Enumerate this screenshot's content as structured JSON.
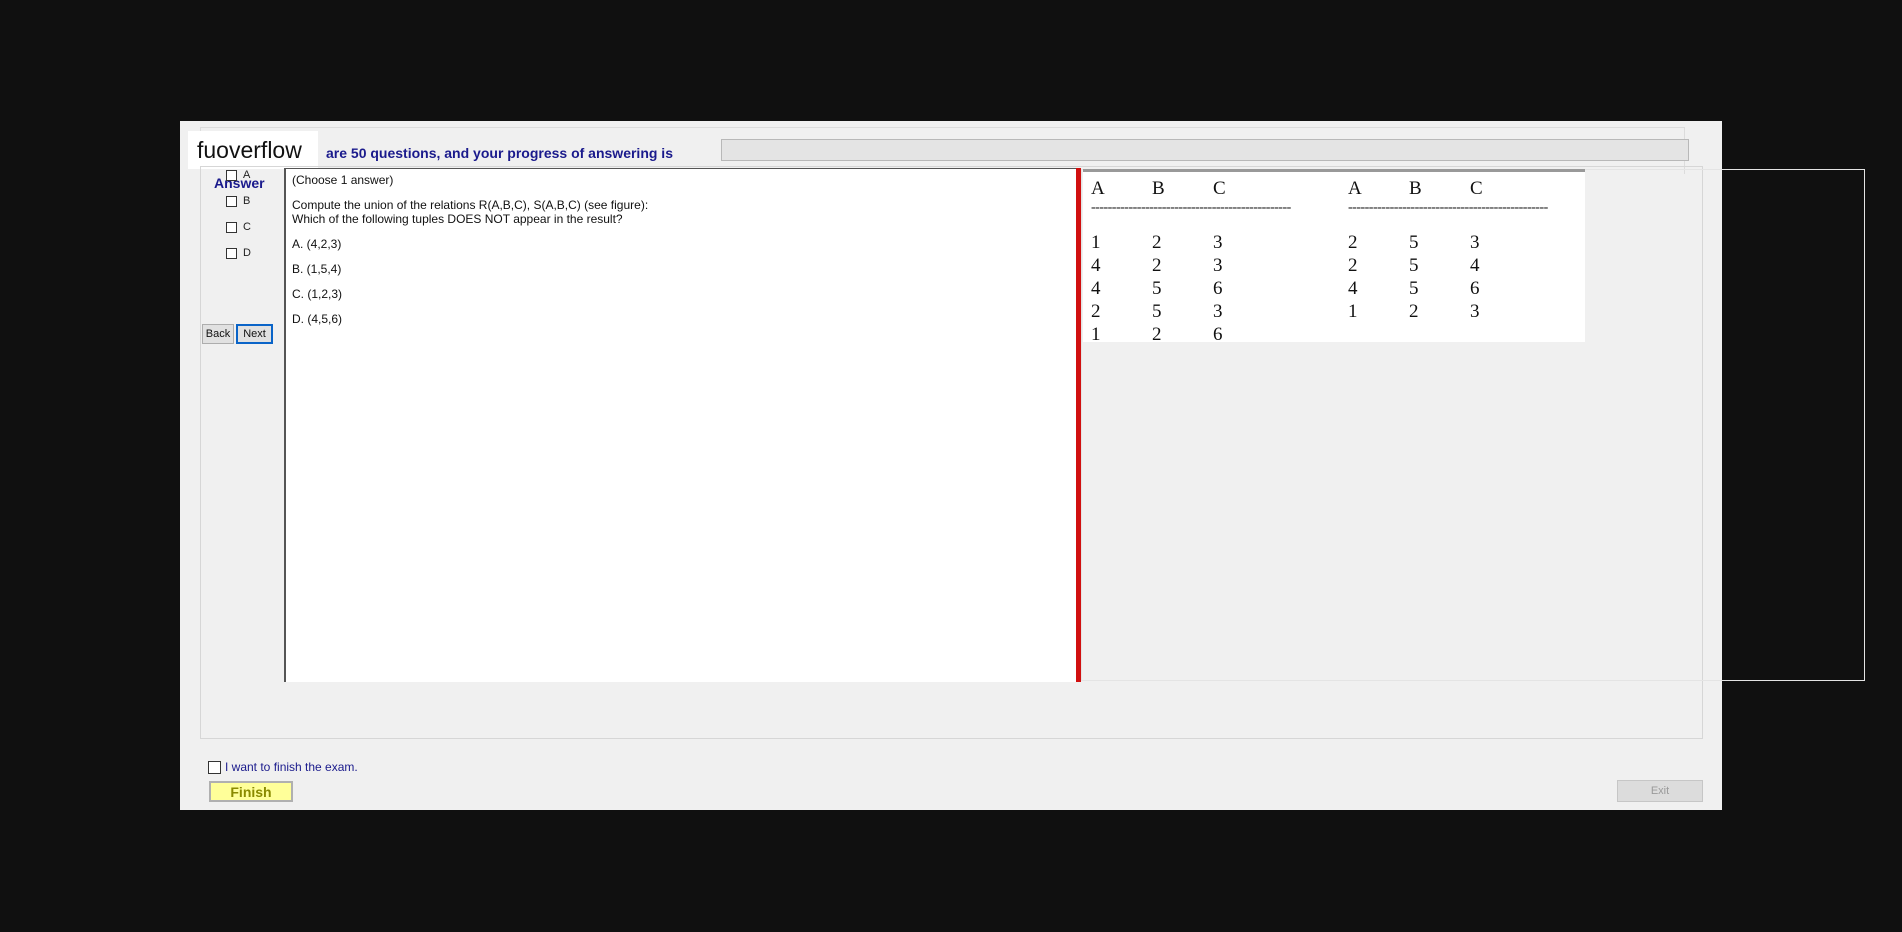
{
  "header": {
    "logo": "fuoverflow",
    "progress_text": "are 50 questions, and your progress of answering is",
    "progress_fraction": 0
  },
  "answer_panel": {
    "title": "Answer",
    "options": [
      "A",
      "B",
      "C",
      "D"
    ],
    "back_label": "Back",
    "next_label": "Next"
  },
  "question": {
    "instruction": "(Choose 1 answer)",
    "text_line1": "Compute the union of the relations R(A,B,C), S(A,B,C) (see figure):",
    "text_line2": "Which of the following tuples DOES NOT appear in the result?",
    "choices": [
      "A.  (4,2,3)",
      "B.  (1,5,4)",
      "C.  (1,2,3)",
      "D.  (4,5,6)"
    ]
  },
  "figure": {
    "relation_r": {
      "headers": [
        "A",
        "B",
        "C"
      ],
      "rows": [
        [
          "1",
          "2",
          "3"
        ],
        [
          "4",
          "2",
          "3"
        ],
        [
          "4",
          "5",
          "6"
        ],
        [
          "2",
          "5",
          "3"
        ],
        [
          "1",
          "2",
          "6"
        ]
      ]
    },
    "relation_s": {
      "headers": [
        "A",
        "B",
        "C"
      ],
      "rows": [
        [
          "2",
          "5",
          "3"
        ],
        [
          "2",
          "5",
          "4"
        ],
        [
          "4",
          "5",
          "6"
        ],
        [
          "1",
          "2",
          "3"
        ]
      ]
    },
    "separator": "------------------------------------------------"
  },
  "footer": {
    "finish_checkbox_label": "I want to finish the exam.",
    "finish_label": "Finish",
    "exit_label": "Exit"
  },
  "colors": {
    "accent_text": "#1a1a8c",
    "splitter": "#d11010",
    "finish_bg": "#ffff99"
  }
}
